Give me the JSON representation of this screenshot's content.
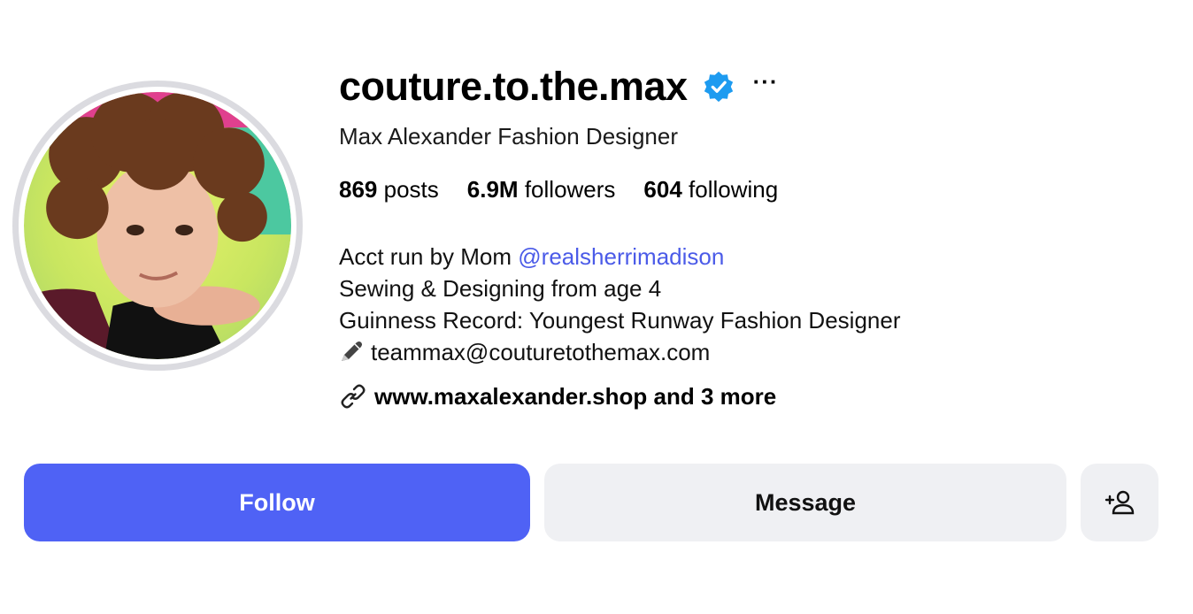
{
  "profile": {
    "username": "couture.to.the.max",
    "full_name": "Max Alexander Fashion Designer",
    "more_label": "···",
    "stats": {
      "posts_count": "869",
      "posts_label": "posts",
      "followers_count": "6.9M",
      "followers_label": "followers",
      "following_count": "604",
      "following_label": "following"
    },
    "bio": {
      "line1_prefix": "Acct run by Mom ",
      "line1_mention": "@realsherrimadison",
      "line2": "Sewing & Designing from age 4",
      "line3": "Guinness Record: Youngest Runway Fashion Designer",
      "line4": "teammax@couturetothemax.com"
    },
    "link_text": "www.maxalexander.shop and 3 more"
  },
  "actions": {
    "follow_label": "Follow",
    "message_label": "Message"
  },
  "icons": {
    "verified": "verified-badge-icon",
    "more": "more-options-icon",
    "pen": "pen-icon",
    "link": "link-icon",
    "add_person": "add-person-icon"
  },
  "colors": {
    "accent": "#4f62f5",
    "mention": "#4b5be8",
    "verified": "#1d9bf0",
    "secondary_button": "#eff0f3"
  }
}
